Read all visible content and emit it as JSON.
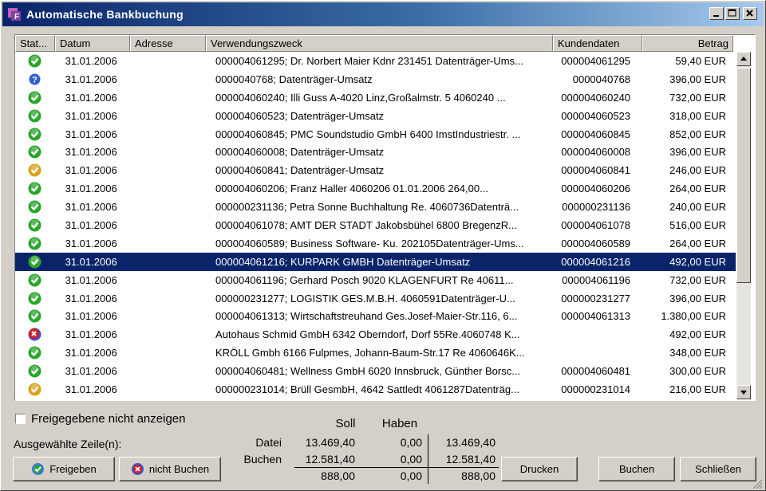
{
  "window": {
    "title": "Automatische Bankbuchung"
  },
  "columns": {
    "status": "Stat...",
    "datum": "Datum",
    "adresse": "Adresse",
    "zweck": "Verwendungszweck",
    "kunde": "Kundendaten",
    "betrag": "Betrag"
  },
  "rows": [
    {
      "status": "ok",
      "datum": "31.01.2006",
      "adresse": "",
      "zweck": "000004061295; Dr. Norbert Maier Kdnr 231451 Datenträger-Ums...",
      "kunde": "000004061295",
      "betrag": "59,40 EUR"
    },
    {
      "status": "question",
      "datum": "31.01.2006",
      "adresse": "",
      "zweck": "0000040768; Datenträger-Umsatz",
      "kunde": "0000040768",
      "betrag": "396,00 EUR"
    },
    {
      "status": "ok",
      "datum": "31.01.2006",
      "adresse": "",
      "zweck": "000004060240; Illi Guss A-4020 Linz,Großalmstr. 5 4060240       ...",
      "kunde": "000004060240",
      "betrag": "732,00 EUR"
    },
    {
      "status": "ok",
      "datum": "31.01.2006",
      "adresse": "",
      "zweck": "000004060523; Datenträger-Umsatz",
      "kunde": "000004060523",
      "betrag": "318,00 EUR"
    },
    {
      "status": "ok",
      "datum": "31.01.2006",
      "adresse": "",
      "zweck": "000004060845; PMC Soundstudio GmbH 6400 ImstIndustriestr. ...",
      "kunde": "000004060845",
      "betrag": "852,00 EUR"
    },
    {
      "status": "ok",
      "datum": "31.01.2006",
      "adresse": "",
      "zweck": "000004060008; Datenträger-Umsatz",
      "kunde": "000004060008",
      "betrag": "396,00 EUR"
    },
    {
      "status": "warn",
      "datum": "31.01.2006",
      "adresse": "",
      "zweck": "000004060841; Datenträger-Umsatz",
      "kunde": "000004060841",
      "betrag": "246,00 EUR"
    },
    {
      "status": "ok",
      "datum": "31.01.2006",
      "adresse": "",
      "zweck": "000004060206; Franz Haller 4060206        01.01.2006       264,00...",
      "kunde": "000004060206",
      "betrag": "264,00 EUR"
    },
    {
      "status": "ok",
      "datum": "31.01.2006",
      "adresse": "",
      "zweck": "000000231136; Petra Sonne Buchhaltung Re. 4060736Datenträ...",
      "kunde": "000000231136",
      "betrag": "240,00 EUR"
    },
    {
      "status": "ok",
      "datum": "31.01.2006",
      "adresse": "",
      "zweck": "000004061078; AMT DER STADT Jakobsbühel 6800 BregenzR...",
      "kunde": "000004061078",
      "betrag": "516,00 EUR"
    },
    {
      "status": "ok",
      "datum": "31.01.2006",
      "adresse": "",
      "zweck": "000004060589; Business Software- Ku. 202105Datenträger-Ums...",
      "kunde": "000004060589",
      "betrag": "264,00 EUR"
    },
    {
      "status": "ok",
      "datum": "31.01.2006",
      "adresse": "",
      "zweck": "000004061216; KURPARK GMBH Datenträger-Umsatz",
      "kunde": "000004061216",
      "betrag": "492,00 EUR",
      "selected": true
    },
    {
      "status": "ok",
      "datum": "31.01.2006",
      "adresse": "",
      "zweck": "000004061196; Gerhard Posch 9020 KLAGENFURT Re 40611...",
      "kunde": "000004061196",
      "betrag": "732,00 EUR"
    },
    {
      "status": "ok",
      "datum": "31.01.2006",
      "adresse": "",
      "zweck": "000000231277; LOGISTIK GES.M.B.H. 4060591Datenträger-U...",
      "kunde": "000000231277",
      "betrag": "396,00 EUR"
    },
    {
      "status": "ok",
      "datum": "31.01.2006",
      "adresse": "",
      "zweck": "000004061313; Wirtschaftstreuhand Ges.Josef-Maier-Str.116, 6...",
      "kunde": "000004061313",
      "betrag": "1.380,00 EUR"
    },
    {
      "status": "error",
      "datum": "31.01.2006",
      "adresse": "",
      "zweck": "Autohaus Schmid GmbH 6342 Oberndorf, Dorf 55Re.4060748  K...",
      "kunde": "",
      "betrag": "492,00 EUR"
    },
    {
      "status": "ok",
      "datum": "31.01.2006",
      "adresse": "",
      "zweck": "KRÖLL Gmbh 6166 Fulpmes, Johann-Baum-Str.17 Re 4060646K...",
      "kunde": "",
      "betrag": "348,00 EUR"
    },
    {
      "status": "ok",
      "datum": "31.01.2006",
      "adresse": "",
      "zweck": "000004060481; Wellness GmbH 6020 Innsbruck, Günther Borsc...",
      "kunde": "000004060481",
      "betrag": "300,00 EUR"
    },
    {
      "status": "warn",
      "datum": "31.01.2006",
      "adresse": "",
      "zweck": "000000231014; Brüll GesmbH, 4642 Sattledt 4061287Datenträg...",
      "kunde": "000000231014",
      "betrag": "216,00 EUR"
    }
  ],
  "options": {
    "hide_approved_label": "Freigegebene nicht anzeigen",
    "hide_approved_checked": false
  },
  "selection_label": "Ausgewählte Zeile(n):",
  "buttons": {
    "freigeben": "Freigeben",
    "nicht_buchen": "nicht Buchen",
    "drucken": "Drucken",
    "buchen": "Buchen",
    "schliessen": "Schließen"
  },
  "summary": {
    "soll_label": "Soll",
    "haben_label": "Haben",
    "datei_label": "Datei",
    "buchen_label": "Buchen",
    "datei": {
      "soll": "13.469,40",
      "haben": "0,00",
      "saldo": "13.469,40"
    },
    "buchen": {
      "soll": "12.581,40",
      "haben": "0,00",
      "saldo": "12.581,40"
    },
    "diff": {
      "soll": "888,00",
      "haben": "0,00",
      "saldo": "888,00"
    }
  },
  "colors": {
    "selection": "#0a246a",
    "ok": "#2aa52a",
    "warn": "#d9a21a",
    "error": "#d42020",
    "question": "#2f5fd0"
  }
}
